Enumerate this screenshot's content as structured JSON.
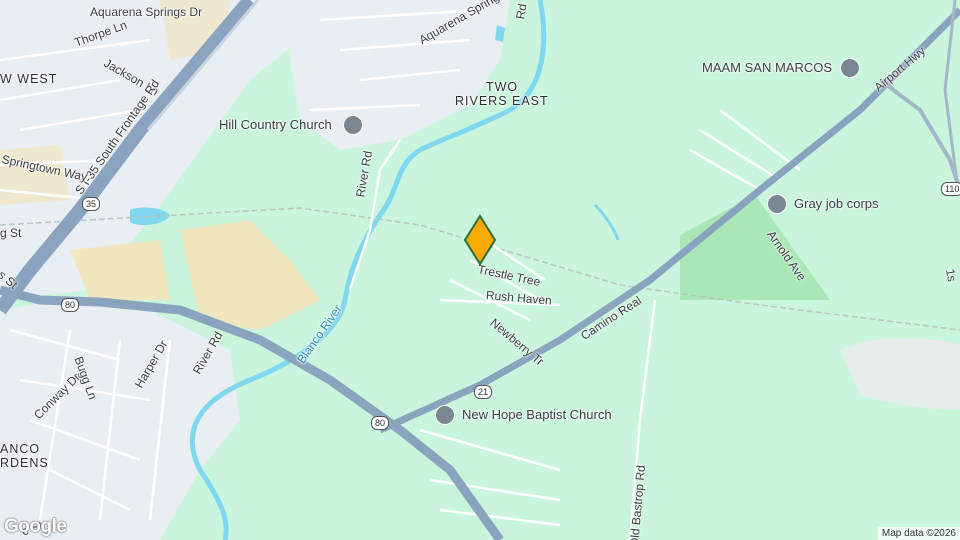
{
  "roads": {
    "aquarena_springs_dr_top": "Aquarena Springs Dr",
    "aquarena_springs_dr_2": "Aquarena Springs Dr",
    "thorpe_ln": "Thorpe Ln",
    "jackson_ln": "Jackson Ln",
    "i35_frontage": "S I-35 South Frontage Rd",
    "springtown_way": "Springtown Way",
    "river_rd_north": "River Rd",
    "river_rd_south": "River Rd",
    "g_st": "g St",
    "s_st": "s St",
    "bugg_ln": "Bugg Ln",
    "harper_dr": "Harper Dr",
    "conway_dr": "Conway Dr",
    "e_st": "e St",
    "trestle_tree": "Trestle Tree",
    "rush_haven": "Rush Haven",
    "newberry_tr": "Newberry Tr",
    "camino_real": "Camino Real",
    "airport_hwy": "Airport Hwy",
    "arnold_ave": "Arnold Ave",
    "old_bastrop_rd": "Old Bastrop Rd",
    "fifteenth_st": "1s",
    "r_rd": "Rd"
  },
  "water": {
    "blanco_river": "Blanco River"
  },
  "areas": {
    "new_west": "W WEST",
    "two_rivers_east_l1": "TWO",
    "two_rivers_east_l2": "RIVERS EAST",
    "blanco_gardens_l1": "ANCO",
    "blanco_gardens_l2": "RDENS"
  },
  "pois": {
    "hill_country_church": "Hill Country Church",
    "maam_san_marcos": "MAAM SAN MARCOS",
    "gray_job_corps": "Gray job corps",
    "new_hope_baptist": "New Hope Baptist Church"
  },
  "shields": {
    "i35": "35",
    "hwy80_a": "80",
    "hwy80_b": "80",
    "hwy21": "21",
    "hwy110": "110"
  },
  "branding": {
    "logo": "Google",
    "attribution": "Map data ©2026"
  },
  "colors": {
    "land": "#c9f5dc",
    "urban": "#e9eef2",
    "water": "#80d8f0",
    "highway": "#8aa4c0",
    "park": "#a9e8b6",
    "sand": "#f2e6bf",
    "marker": "#f9ab00"
  }
}
